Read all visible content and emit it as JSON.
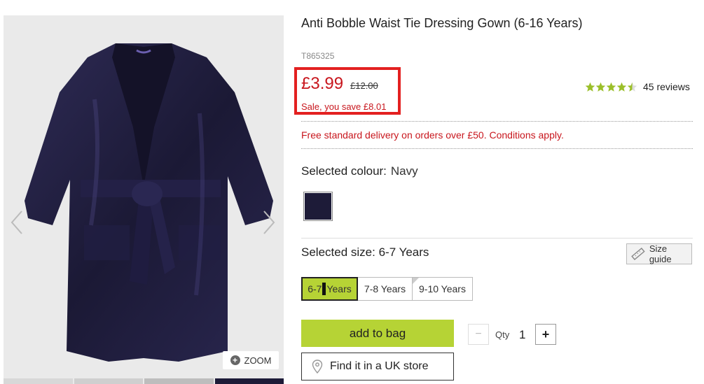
{
  "product": {
    "title": "Anti Bobble Waist Tie Dressing Gown (6-16 Years)",
    "sku": "T865325"
  },
  "price": {
    "now": "£3.99",
    "was": "£12.00",
    "saving": "Sale, you save £8.01",
    "highlight_color": "#e32020"
  },
  "rating": {
    "stars": 4.5,
    "reviews_label": "45 reviews"
  },
  "delivery": {
    "text": "Free standard delivery on orders over £50. Conditions apply."
  },
  "colour": {
    "label": "Selected colour:",
    "value": "Navy",
    "swatch_color": "#1d1b38"
  },
  "size": {
    "label": "Selected size:",
    "value": "6-7 Years",
    "guide_label": "Size guide",
    "options": [
      {
        "label_pre": "6-7",
        "label_post": "Years",
        "selected": true
      },
      {
        "label": "7-8 Years",
        "selected": false
      },
      {
        "label": "9-10 Years",
        "selected": false,
        "low_stock": true
      }
    ]
  },
  "gallery": {
    "zoom_label": "ZOOM"
  },
  "actions": {
    "add_to_bag": "add to bag",
    "qty_label": "Qty",
    "qty_value": "1",
    "minus": "−",
    "plus": "+",
    "find_store": "Find it in a UK store"
  },
  "colors": {
    "accent_green": "#b6d335",
    "sale_red": "#c8161d",
    "robe_navy": "#1d1b38"
  }
}
